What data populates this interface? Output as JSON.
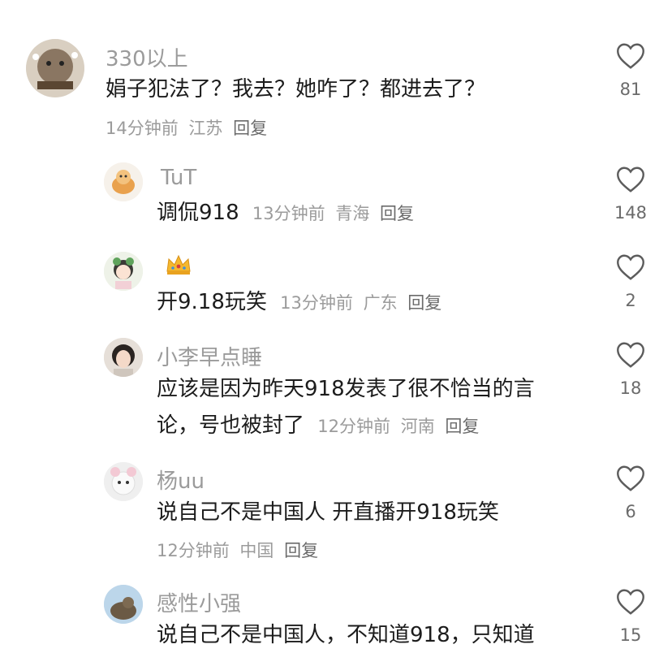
{
  "comments": [
    {
      "name": "330以上",
      "text": "娟子犯法了？我去？她咋了？都进去了？",
      "time": "14分钟前",
      "location": "江苏",
      "reply": "回复",
      "likes": "81"
    },
    {
      "name": "TuT",
      "text": "调侃918",
      "time": "13分钟前",
      "location": "青海",
      "reply": "回复",
      "likes": "148"
    },
    {
      "name": "",
      "badge_icon": "crown-icon",
      "text": "开9.18玩笑",
      "time": "13分钟前",
      "location": "广东",
      "reply": "回复",
      "likes": "2"
    },
    {
      "name": "小李早点睡",
      "text_line1": "应该是因为昨天918发表了很不恰当的言",
      "text_line2": "论，号也被封了",
      "time": "12分钟前",
      "location": "河南",
      "reply": "回复",
      "likes": "18"
    },
    {
      "name": "杨uu",
      "text": "说自己不是中国人 开直播开918玩笑",
      "time": "12分钟前",
      "location": "中国",
      "reply": "回复",
      "likes": "6"
    },
    {
      "name": "感性小强",
      "text": "说自己不是中国人，不知道918，只知道",
      "likes": "15"
    }
  ],
  "colors": {
    "muted": "#9b9b9b",
    "text": "#1c1c1c",
    "background": "#ffffff"
  }
}
